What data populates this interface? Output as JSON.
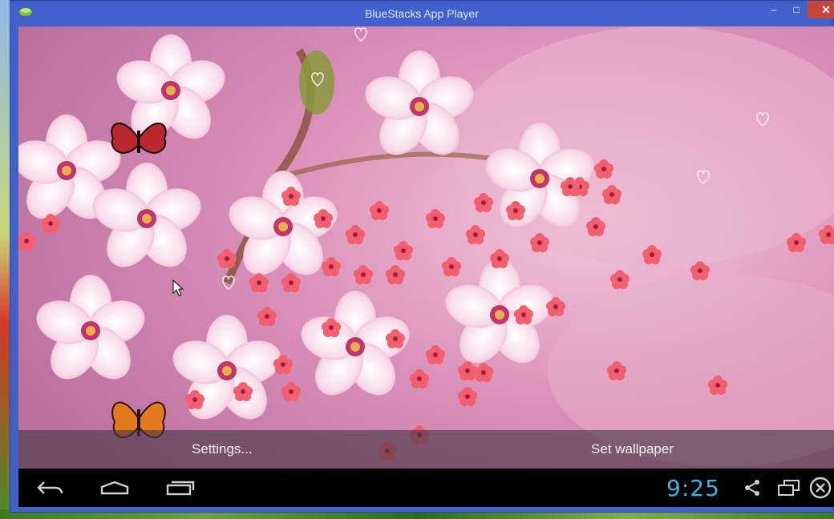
{
  "window": {
    "title": "BlueStacks App Player",
    "minimize_label": "–",
    "maximize_label": "□",
    "close_label": "✕"
  },
  "action_bar": {
    "settings_label": "Settings...",
    "set_wallpaper_label": "Set wallpaper"
  },
  "navbar": {
    "back_icon": "back-arrow-icon",
    "home_icon": "home-icon",
    "recents_icon": "recent-apps-icon",
    "clock": "9:25",
    "share_icon": "share-icon",
    "screen_icon": "screen-rotate-icon",
    "close_icon": "close-app-icon"
  },
  "colors": {
    "window_frame": "#3f61c9",
    "clock": "#33b5e5",
    "close_button": "#c7453b",
    "action_bar": "#463746"
  }
}
